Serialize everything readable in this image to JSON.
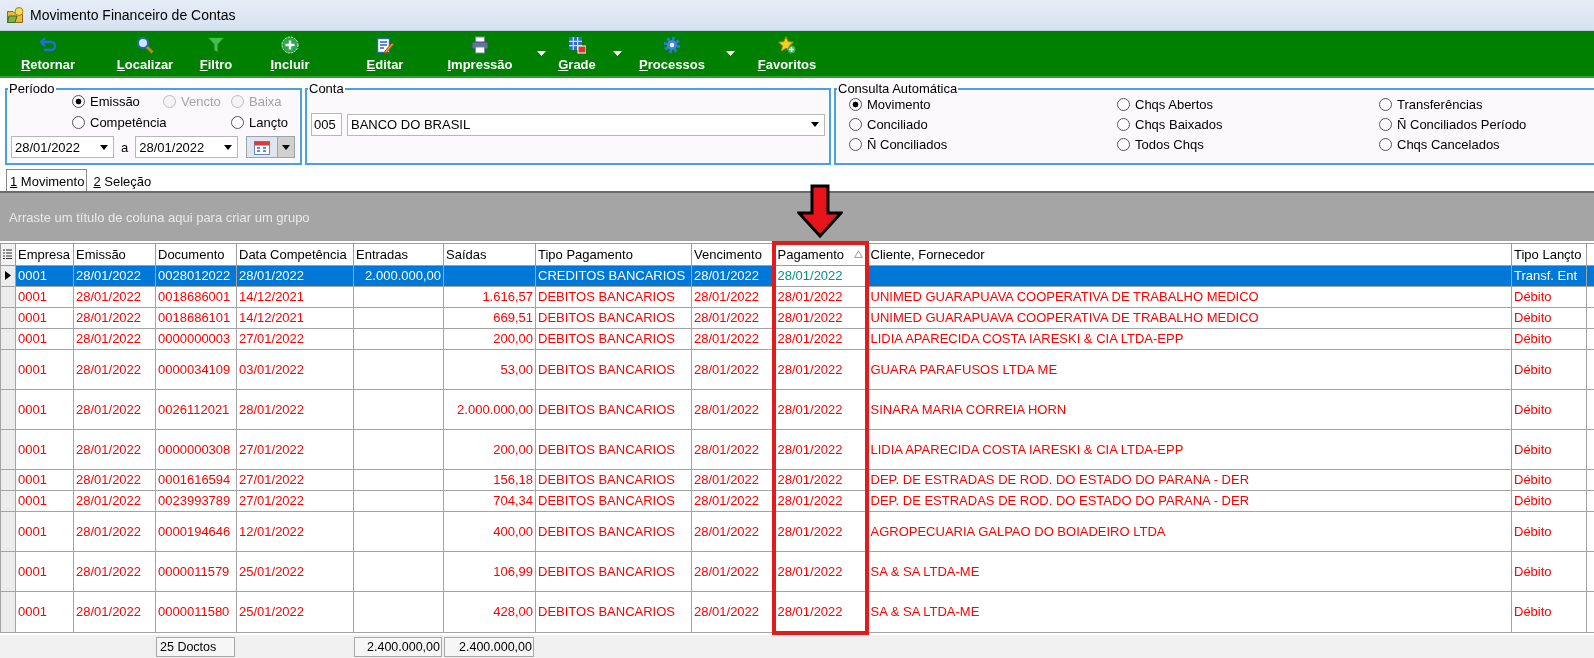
{
  "window": {
    "title": "Movimento Financeiro de Contas"
  },
  "toolbar": [
    {
      "label": "Retornar",
      "menu": false
    },
    {
      "label": "Localizar",
      "menu": false
    },
    {
      "label": "Filtro",
      "menu": false
    },
    {
      "label": "Incluir",
      "menu": false
    },
    {
      "label": "Editar",
      "menu": false
    },
    {
      "label": "Impressão",
      "menu": true
    },
    {
      "label": "Grade",
      "menu": true
    },
    {
      "label": "Processos",
      "menu": true
    },
    {
      "label": "Favoritos",
      "menu": false
    }
  ],
  "period": {
    "title": "Período",
    "options": [
      {
        "label": "Emissão",
        "selected": true,
        "disabled": false
      },
      {
        "label": "Vencto",
        "selected": false,
        "disabled": true
      },
      {
        "label": "Baixa",
        "selected": false,
        "disabled": true
      },
      {
        "label": "Competência",
        "selected": false,
        "disabled": false
      },
      {
        "label": "Lançto",
        "selected": false,
        "disabled": false
      }
    ],
    "date_from": "28/01/2022",
    "separator": "a",
    "date_to": "28/01/2022"
  },
  "account": {
    "title": "Conta",
    "code": "005",
    "name": "BANCO DO BRASIL"
  },
  "auto_query": {
    "title": "Consulta Automática",
    "options": [
      {
        "label": "Movimento",
        "selected": true
      },
      {
        "label": "Chqs Abertos",
        "selected": false
      },
      {
        "label": "Transferências",
        "selected": false
      },
      {
        "label": "Conciliado",
        "selected": false
      },
      {
        "label": "Chqs Baixados",
        "selected": false
      },
      {
        "label": "Ñ Conciliados Período",
        "selected": false
      },
      {
        "label": "Ñ Conciliados",
        "selected": false
      },
      {
        "label": "Todos Chqs",
        "selected": false
      },
      {
        "label": "Chqs Cancelados",
        "selected": false
      }
    ]
  },
  "tabs": [
    {
      "label": "1 Movimento",
      "selected": true
    },
    {
      "label": "2 Seleção",
      "selected": false
    }
  ],
  "group_panel": {
    "hint": "Arraste um título de coluna aqui para criar um grupo"
  },
  "table": {
    "columns": [
      {
        "label": "Empresa",
        "kind": "text",
        "sorted": false,
        "focused": false,
        "highlighted": false
      },
      {
        "label": "Emissão",
        "kind": "text",
        "sorted": false,
        "focused": false,
        "highlighted": false
      },
      {
        "label": "Documento",
        "kind": "text",
        "sorted": false,
        "focused": false,
        "highlighted": false,
        "total": "25 Doctos"
      },
      {
        "label": "Data Competência",
        "kind": "text",
        "sorted": false,
        "focused": false,
        "highlighted": false
      },
      {
        "label": "Entradas",
        "kind": "money",
        "sorted": false,
        "focused": false,
        "highlighted": false,
        "total": "2.400.000,00"
      },
      {
        "label": "Saídas",
        "kind": "money",
        "sorted": false,
        "focused": false,
        "highlighted": false,
        "total": "2.400.000,00"
      },
      {
        "label": "Tipo Pagamento",
        "kind": "text",
        "sorted": false,
        "focused": false,
        "highlighted": false
      },
      {
        "label": "Vencimento",
        "kind": "text",
        "sorted": false,
        "focused": false,
        "highlighted": false
      },
      {
        "label": "Pagamento",
        "kind": "text",
        "sorted": true,
        "focused": true,
        "highlighted": true
      },
      {
        "label": "Cliente, Fornecedor",
        "kind": "text",
        "sorted": false,
        "focused": false,
        "highlighted": false
      },
      {
        "label": "Tipo Lançto",
        "kind": "text",
        "sorted": false,
        "focused": false,
        "highlighted": false
      }
    ],
    "rows": [
      {
        "selected": true,
        "kind": "short",
        "cells": [
          "0001",
          "28/01/2022",
          "0028012022",
          "28/01/2022",
          "2.000.000,00",
          null,
          "CREDITOS BANCARIOS",
          "28/01/2022",
          "28/01/2022",
          null,
          "Transf. Ent"
        ]
      },
      {
        "selected": false,
        "kind": "short",
        "cells": [
          "0001",
          "28/01/2022",
          "0018686001",
          "14/12/2021",
          null,
          "1.616,57",
          "DEBITOS BANCARIOS",
          "28/01/2022",
          "28/01/2022",
          "UNIMED GUARAPUAVA COOPERATIVA DE TRABALHO MEDICO",
          "Débito"
        ]
      },
      {
        "selected": false,
        "kind": "short",
        "cells": [
          "0001",
          "28/01/2022",
          "0018686101",
          "14/12/2021",
          null,
          "669,51",
          "DEBITOS BANCARIOS",
          "28/01/2022",
          "28/01/2022",
          "UNIMED GUARAPUAVA COOPERATIVA DE TRABALHO MEDICO",
          "Débito"
        ]
      },
      {
        "selected": false,
        "kind": "short",
        "cells": [
          "0001",
          "28/01/2022",
          "0000000003",
          "27/01/2022",
          null,
          "200,00",
          "DEBITOS BANCARIOS",
          "28/01/2022",
          "28/01/2022",
          "LIDIA APARECIDA COSTA IARESKI & CIA LTDA-EPP",
          "Débito"
        ]
      },
      {
        "selected": false,
        "kind": "tall",
        "cells": [
          "0001",
          "28/01/2022",
          "0000034109",
          "03/01/2022",
          null,
          "53,00",
          "DEBITOS BANCARIOS",
          "28/01/2022",
          "28/01/2022",
          "GUARA PARAFUSOS LTDA ME",
          "Débito"
        ]
      },
      {
        "selected": false,
        "kind": "tall",
        "cells": [
          "0001",
          "28/01/2022",
          "0026112021",
          "28/01/2022",
          null,
          "2.000.000,00",
          "DEBITOS BANCARIOS",
          "28/01/2022",
          "28/01/2022",
          "SINARA MARIA CORREIA HORN",
          "Débito"
        ]
      },
      {
        "selected": false,
        "kind": "tall",
        "cells": [
          "0001",
          "28/01/2022",
          "0000000308",
          "27/01/2022",
          null,
          "200,00",
          "DEBITOS BANCARIOS",
          "28/01/2022",
          "28/01/2022",
          "LIDIA APARECIDA COSTA IARESKI & CIA LTDA-EPP",
          "Débito"
        ]
      },
      {
        "selected": false,
        "kind": "short",
        "cells": [
          "0001",
          "28/01/2022",
          "0001616594",
          "27/01/2022",
          null,
          "156,18",
          "DEBITOS BANCARIOS",
          "28/01/2022",
          "28/01/2022",
          "DEP. DE ESTRADAS DE ROD. DO ESTADO DO PARANA - DER",
          "Débito"
        ]
      },
      {
        "selected": false,
        "kind": "short",
        "cells": [
          "0001",
          "28/01/2022",
          "0023993789",
          "27/01/2022",
          null,
          "704,34",
          "DEBITOS BANCARIOS",
          "28/01/2022",
          "28/01/2022",
          "DEP. DE ESTRADAS DE ROD. DO ESTADO DO PARANA - DER",
          "Débito"
        ]
      },
      {
        "selected": false,
        "kind": "tall",
        "cells": [
          "0001",
          "28/01/2022",
          "0000194646",
          "12/01/2022",
          null,
          "400,00",
          "DEBITOS BANCARIOS",
          "28/01/2022",
          "28/01/2022",
          "AGROPECUARIA GALPAO DO BOIADEIRO LTDA",
          "Débito"
        ]
      },
      {
        "selected": false,
        "kind": "tall",
        "cells": [
          "0001",
          "28/01/2022",
          "0000011579",
          "25/01/2022",
          null,
          "106,99",
          "DEBITOS BANCARIOS",
          "28/01/2022",
          "28/01/2022",
          "SA & SA LTDA-ME",
          "Débito"
        ]
      },
      {
        "selected": false,
        "kind": "tall",
        "cells": [
          "0001",
          "28/01/2022",
          "0000011580",
          "25/01/2022",
          null,
          "428,00",
          "DEBITOS BANCARIOS",
          "28/01/2022",
          "28/01/2022",
          "SA & SA LTDA-ME",
          "Débito"
        ]
      }
    ]
  }
}
